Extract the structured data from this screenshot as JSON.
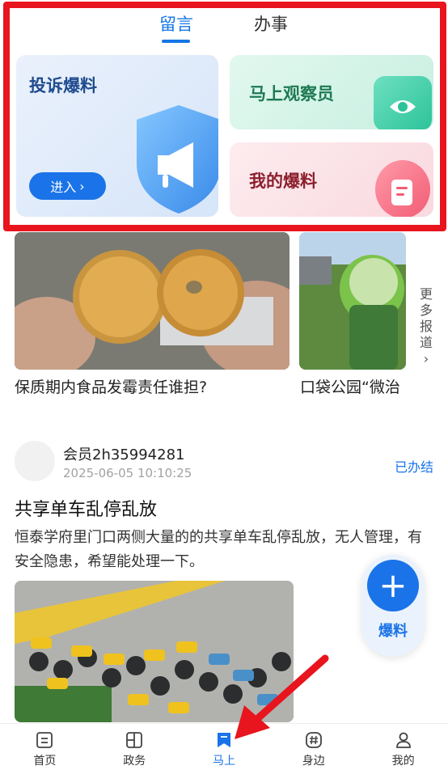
{
  "tabs": [
    {
      "label": "留言",
      "active": true
    },
    {
      "label": "办事",
      "active": false
    }
  ],
  "cards": {
    "complaint": {
      "title": "投诉爆料",
      "enter_label": "进入",
      "enter_icon": "chevron-right-icon"
    },
    "observer": {
      "title": "马上观察员",
      "icon": "eye-icon"
    },
    "mine": {
      "title": "我的爆料",
      "icon": "document-icon"
    }
  },
  "news": {
    "items": [
      {
        "title": "保质期内食品发霉责任谁担?"
      },
      {
        "title": "口袋公园“微治"
      }
    ],
    "more_label": "更多报道"
  },
  "post": {
    "username": "会员2h35994281",
    "time": "2025-06-05 10:10:25",
    "status": "已办结",
    "title": "共享单车乱停乱放",
    "body": "恒泰学府里门口两侧大量的的共享单车乱停乱放，无人管理，有安全隐患，希望能处理一下。"
  },
  "fab": {
    "label": "爆料",
    "icon": "plus-icon"
  },
  "bottom_nav": [
    {
      "label": "首页",
      "icon": "home-icon",
      "active": false
    },
    {
      "label": "政务",
      "icon": "government-icon",
      "active": false
    },
    {
      "label": "马上",
      "icon": "bookmark-icon",
      "active": true
    },
    {
      "label": "身边",
      "icon": "hashtag-icon",
      "active": false
    },
    {
      "label": "我的",
      "icon": "user-icon",
      "active": false
    }
  ],
  "colors": {
    "accent": "#1a73e8",
    "highlight": "#e8141e"
  }
}
